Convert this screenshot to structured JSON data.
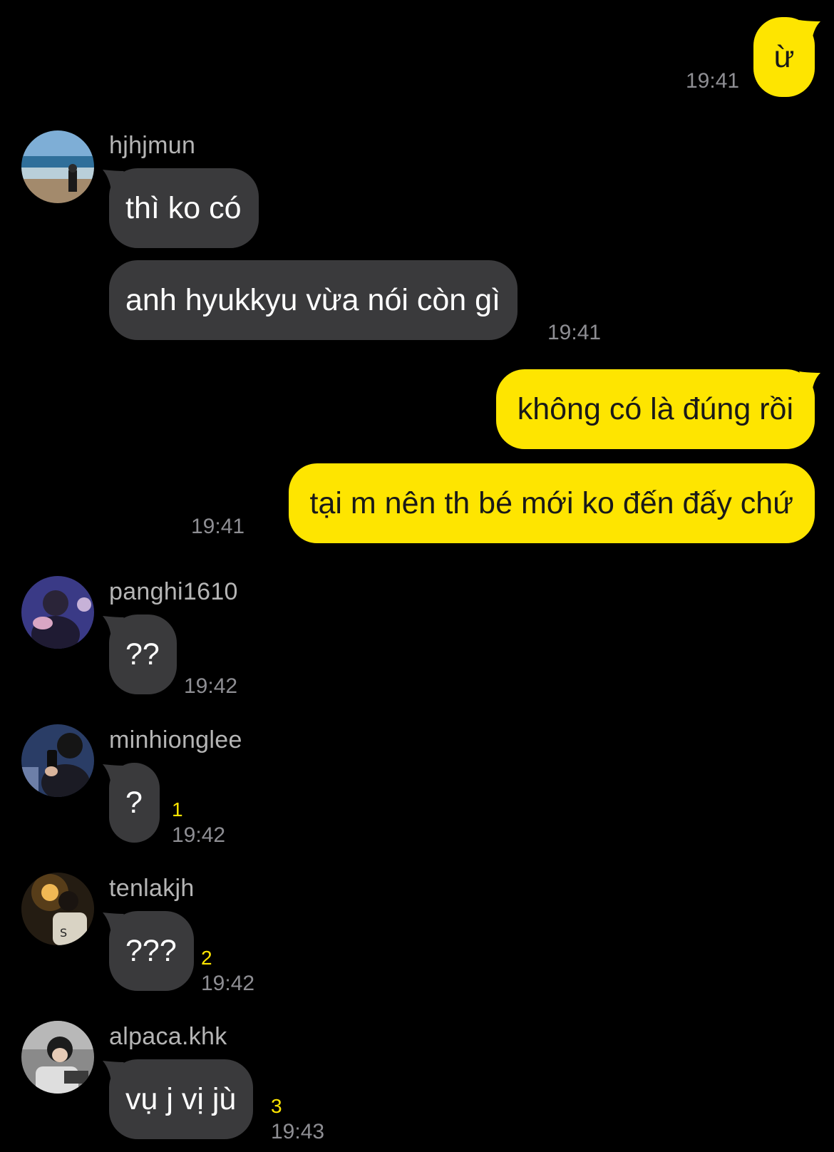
{
  "colors": {
    "background": "#000000",
    "outgoing_bubble": "#fee500",
    "incoming_bubble": "#3a3a3c",
    "timestamp": "#8e8e93",
    "unread_count": "#fee500",
    "sender_name": "#b5b5b5"
  },
  "messages": [
    {
      "direction": "outgoing",
      "text": "ừ",
      "time": "19:41"
    },
    {
      "direction": "incoming",
      "sender": "hjhjmun",
      "avatar_icon": "beach-photo-avatar",
      "texts": [
        "thì ko có",
        "anh hyukkyu vừa nói còn gì"
      ],
      "time": "19:41"
    },
    {
      "direction": "outgoing",
      "texts": [
        "không có là đúng rồi",
        "tại m nên th bé mới ko đến đấy chứ"
      ],
      "time": "19:41"
    },
    {
      "direction": "incoming",
      "sender": "panghi1610",
      "avatar_icon": "person-photo-avatar",
      "text": "??",
      "time": "19:42"
    },
    {
      "direction": "incoming",
      "sender": "minhionglee",
      "avatar_icon": "phone-photo-avatar",
      "text": "?",
      "unread": "1",
      "time": "19:42"
    },
    {
      "direction": "incoming",
      "sender": "tenlakjh",
      "avatar_icon": "night-photo-avatar",
      "text": "???",
      "unread": "2",
      "time": "19:42"
    },
    {
      "direction": "incoming",
      "sender": "alpaca.khk",
      "avatar_icon": "person-photo-avatar",
      "text": "vụ j vị jù",
      "unread": "3",
      "time": "19:43"
    }
  ]
}
